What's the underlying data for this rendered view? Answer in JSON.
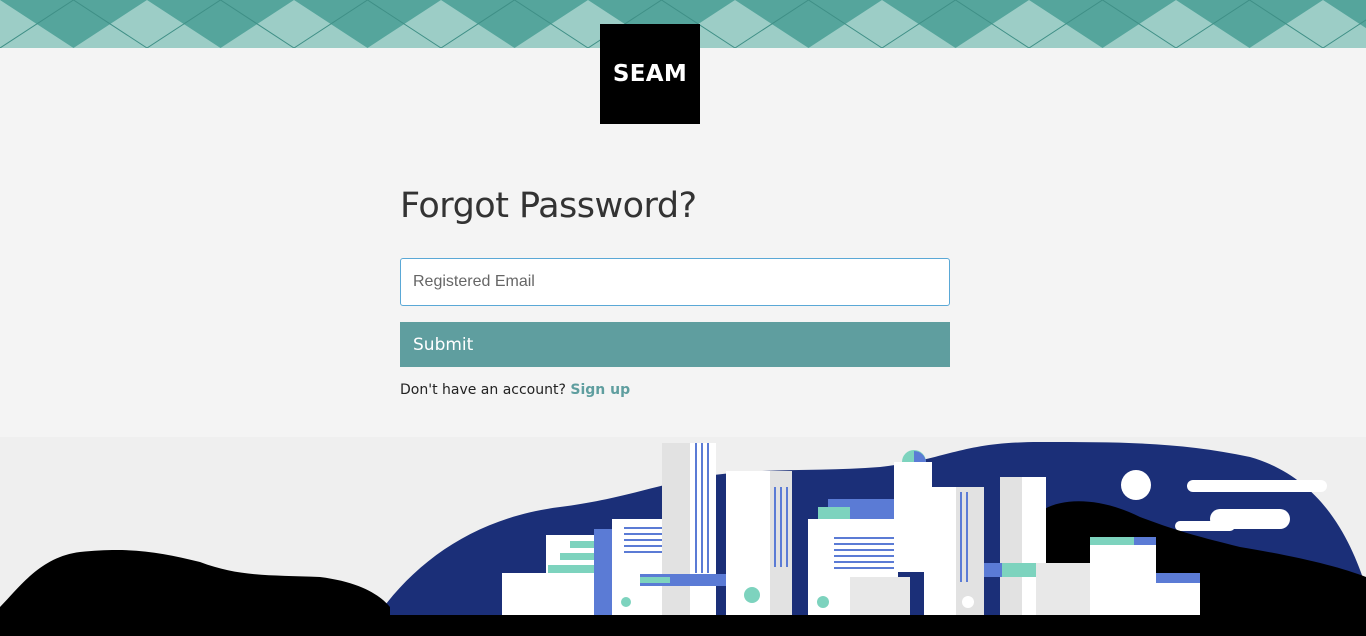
{
  "brand": {
    "logo_text": "SEAM"
  },
  "form": {
    "title": "Forgot Password?",
    "email_placeholder": "Registered Email",
    "email_value": "",
    "submit_label": "Submit",
    "signup_prompt": "Don't have an account?",
    "signup_link": "Sign up"
  },
  "colors": {
    "accent": "#5f9e9f",
    "pattern_light": "#9ccdc6",
    "pattern_dark": "#55a59c",
    "city_navy": "#1b2f78",
    "city_blue": "#5b7bd5",
    "city_mint": "#7dd3be"
  },
  "icons": [
    "city-illustration",
    "geometric-pattern"
  ]
}
